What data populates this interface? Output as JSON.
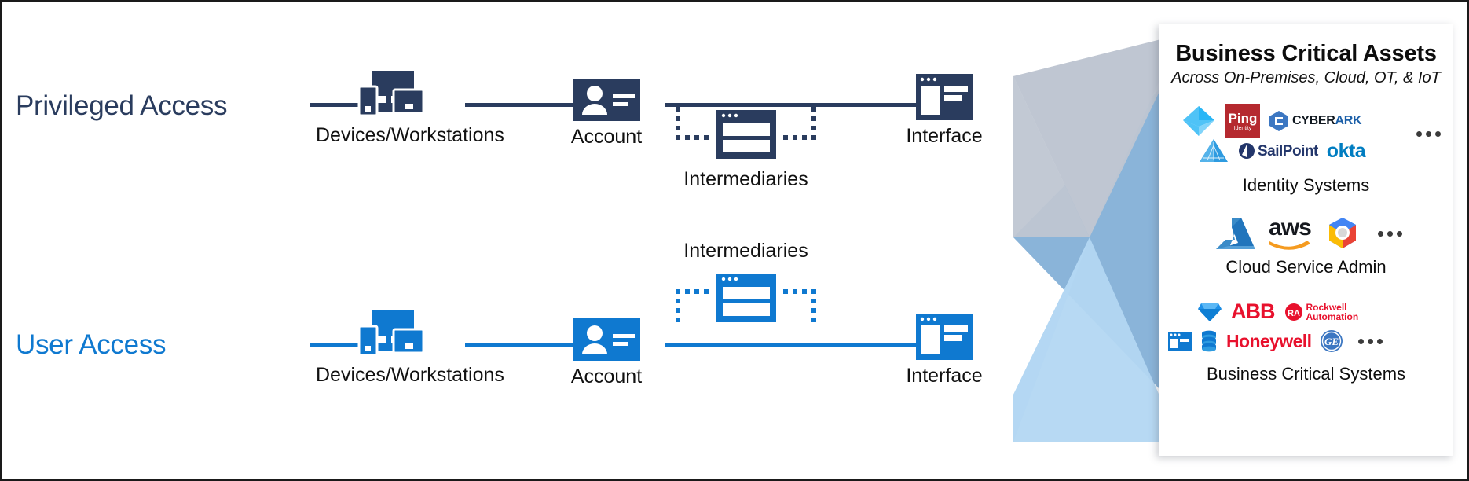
{
  "diagram": {
    "title": "Privileged Access / User Access pathways to Business Critical Assets",
    "colors": {
      "privileged": "#2A3C5E",
      "user": "#0F79D0",
      "funnel_grey": "#BFC6D2",
      "funnel_light_blue": "#B3D7F2",
      "funnel_mid_blue": "#80AED6"
    }
  },
  "rows": [
    {
      "id": "privileged",
      "label": "Privileged Access",
      "accent": "#2A3C5E",
      "intermediaries_position": "below",
      "nodes": [
        {
          "name": "devices",
          "caption": "Devices/Workstations",
          "icon": "devices-workstations-icon"
        },
        {
          "name": "account",
          "caption": "Account",
          "icon": "account-card-icon"
        },
        {
          "name": "intermediaries",
          "caption": "Intermediaries",
          "icon": "intermediary-window-icon"
        },
        {
          "name": "interface",
          "caption": "Interface",
          "icon": "interface-window-icon"
        }
      ]
    },
    {
      "id": "user",
      "label": "User Access",
      "accent": "#0F79D0",
      "intermediaries_position": "above",
      "nodes": [
        {
          "name": "devices",
          "caption": "Devices/Workstations",
          "icon": "devices-workstations-icon"
        },
        {
          "name": "account",
          "caption": "Account",
          "icon": "account-card-icon"
        },
        {
          "name": "intermediaries",
          "caption": "Intermediaries",
          "icon": "intermediary-window-icon"
        },
        {
          "name": "interface",
          "caption": "Interface",
          "icon": "interface-window-icon"
        }
      ]
    }
  ],
  "panel": {
    "title": "Business Critical Assets",
    "subtitle": "Across On-Premises, Cloud, OT, & IoT",
    "groups": [
      {
        "id": "identity",
        "label": "Identity Systems",
        "logos": [
          {
            "name": "azure-ad-logo",
            "text": ""
          },
          {
            "name": "ping-identity-logo",
            "text": "Ping",
            "sub": "Identity"
          },
          {
            "name": "cyberark-logo",
            "text": "CYBERARK"
          },
          {
            "name": "pyramid-identity-logo",
            "text": ""
          },
          {
            "name": "sailpoint-logo",
            "text": "SailPoint"
          },
          {
            "name": "okta-logo",
            "text": "okta"
          }
        ],
        "overflow": "..."
      },
      {
        "id": "cloud",
        "label": "Cloud Service Admin",
        "logos": [
          {
            "name": "azure-logo",
            "text": ""
          },
          {
            "name": "aws-logo",
            "text": "aws"
          },
          {
            "name": "google-cloud-logo",
            "text": ""
          }
        ],
        "overflow": "..."
      },
      {
        "id": "business",
        "label": "Business Critical Systems",
        "logos": [
          {
            "name": "gem-diamond-logo",
            "text": ""
          },
          {
            "name": "abb-logo",
            "text": "ABB"
          },
          {
            "name": "rockwell-automation-logo",
            "text": "Rockwell",
            "sub": "Automation"
          },
          {
            "name": "interface-app-logo",
            "text": ""
          },
          {
            "name": "database-logo",
            "text": ""
          },
          {
            "name": "honeywell-logo",
            "text": "Honeywell"
          },
          {
            "name": "ge-logo",
            "text": "GE"
          }
        ],
        "overflow": "..."
      }
    ]
  }
}
